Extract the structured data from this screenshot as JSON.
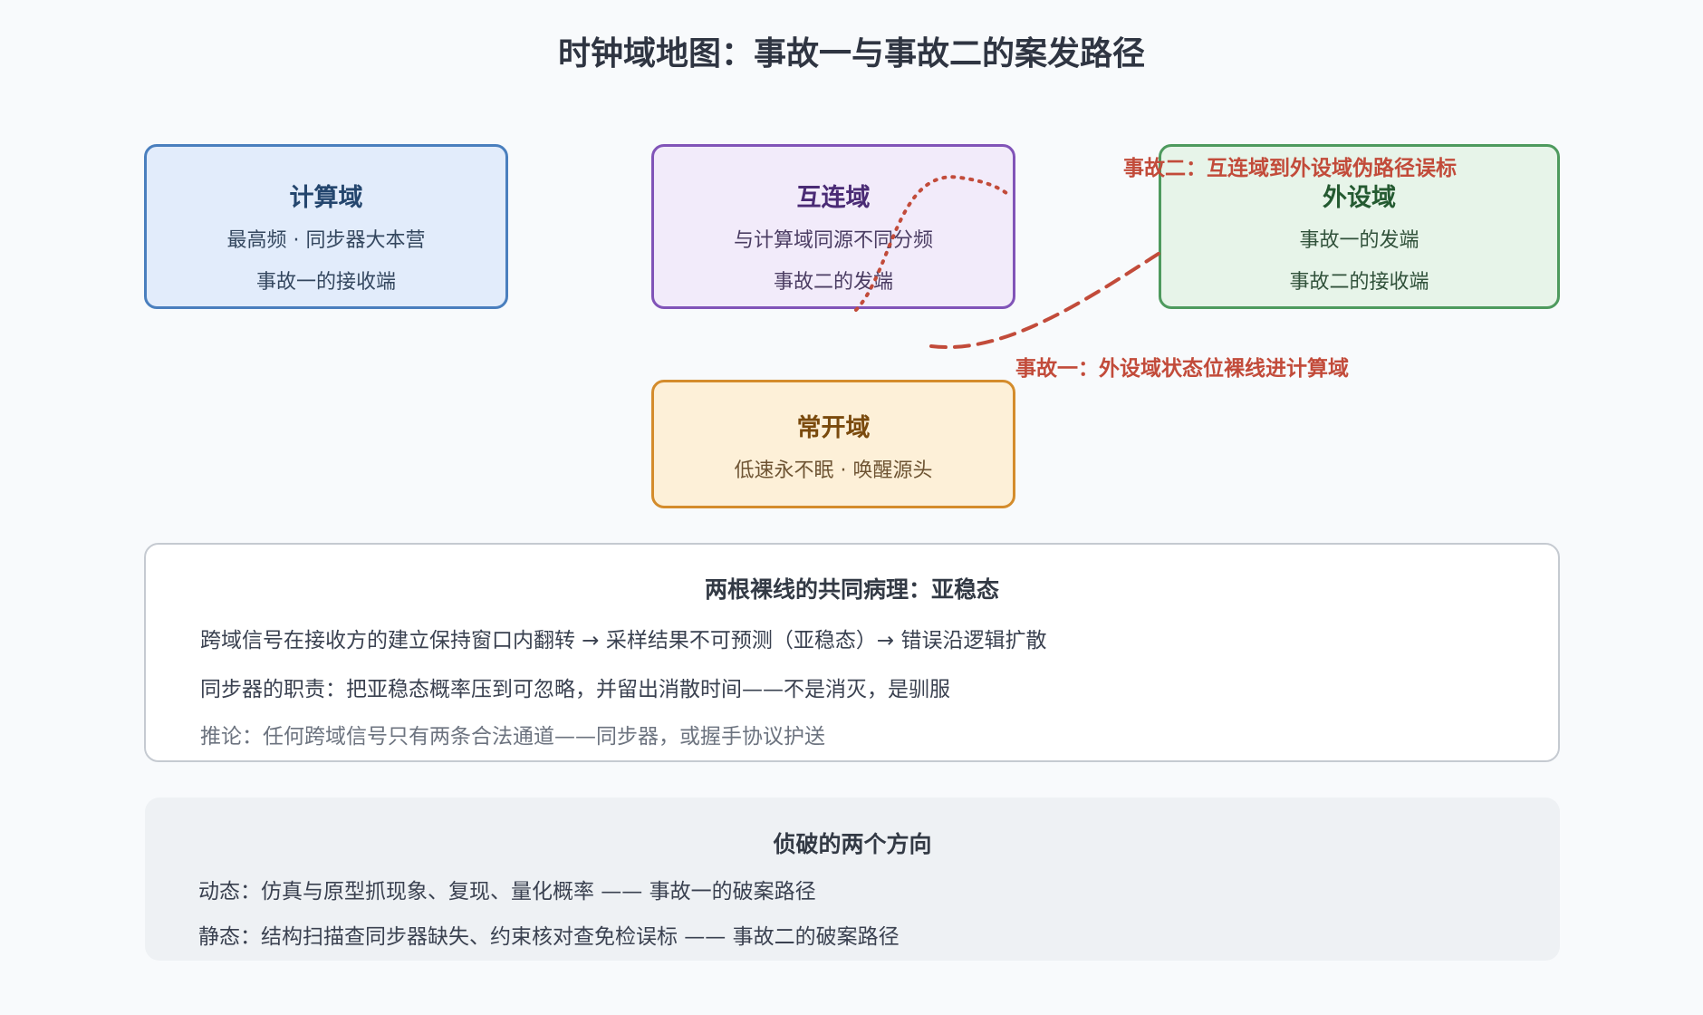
{
  "title": "时钟域地图：事故一与事故二的案发路径",
  "domains": {
    "compute": {
      "name": "计算域",
      "lines": [
        "最高频 · 同步器大本营",
        "事故一的接收端"
      ],
      "color": "#4a7fbe"
    },
    "interconnect": {
      "name": "互连域",
      "lines": [
        "与计算域同源不同分频",
        "事故二的发端"
      ],
      "color": "#8154b8"
    },
    "peripheral": {
      "name": "外设域",
      "lines": [
        "事故一的发端",
        "事故二的接收端"
      ],
      "color": "#4e9a5e"
    },
    "always_on": {
      "name": "常开域",
      "lines": [
        "低速永不眠 · 唤醒源头"
      ],
      "color": "#d48c2c"
    }
  },
  "paths": {
    "incident1": {
      "label": "事故一：外设域状态位裸线进计算域",
      "style": "dashed",
      "color": "#c24b3a"
    },
    "incident2": {
      "label": "事故二：互连域到外设域伪路径误标",
      "style": "dotted",
      "color": "#c24b3a"
    }
  },
  "pathology": {
    "title": "两根裸线的共同病理：亚稳态",
    "lines": [
      "跨域信号在接收方的建立保持窗口内翻转 → 采样结果不可预测（亚稳态）→ 错误沿逻辑扩散",
      "同步器的职责：把亚稳态概率压到可忽略，并留出消散时间——不是消灭，是驯服",
      "推论：任何跨域信号只有两条合法通道——同步器，或握手协议护送"
    ]
  },
  "directions": {
    "title": "侦破的两个方向",
    "lines": [
      "动态：仿真与原型抓现象、复现、量化概率 —— 事故一的破案路径",
      "静态：结构扫描查同步器缺失、约束核对查免检误标 —— 事故二的破案路径"
    ]
  }
}
